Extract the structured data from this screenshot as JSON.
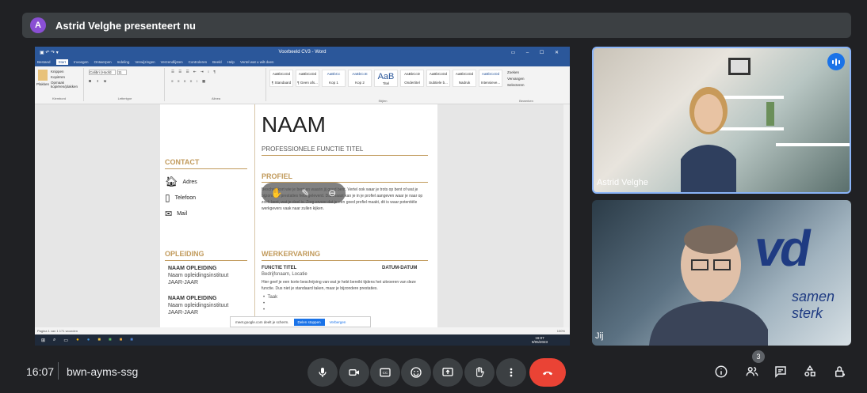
{
  "header": {
    "avatar_letter": "A",
    "presenting_text": "Astrid Velghe presenteert nu"
  },
  "word": {
    "window_title": "Voorbeeld CV3  -  Word",
    "tabs": [
      "Bestand",
      "Start",
      "Invoegen",
      "Ontwerpen",
      "Indeling",
      "Verwijzingen",
      "Verzendlijsten",
      "Controleren",
      "Beeld",
      "Help",
      "Vertel wat u wilt doen"
    ],
    "active_tab": "Start",
    "clipboard": {
      "paste": "Plakken",
      "cut": "Knippen",
      "copy": "Kopiëren",
      "painter": "Opmaak kopiëren/plakken",
      "label": "Klembord"
    },
    "font": {
      "name": "Calibri (Hoofd",
      "size": "11",
      "label": "Lettertype"
    },
    "paragraph_label": "Alinea",
    "styles": [
      {
        "sample": "AaBbCcDd",
        "name": "¶ Standaard"
      },
      {
        "sample": "AaBbCcDd",
        "name": "¶ Geen afs..."
      },
      {
        "sample": "AaBbCc",
        "name": "Kop 1"
      },
      {
        "sample": "AaBbCcE",
        "name": "Kop 2"
      },
      {
        "sample": "AaB",
        "name": "Titel"
      },
      {
        "sample": "AaBbCcD",
        "name": "Ondertitel"
      },
      {
        "sample": "AaBbCcDd",
        "name": "Subtiele b..."
      },
      {
        "sample": "AaBbCcDd",
        "name": "Nadruk"
      },
      {
        "sample": "AaBbCcDd",
        "name": "Intensieve..."
      }
    ],
    "styles_label": "Stijlen",
    "editing": {
      "find": "Zoeken",
      "replace": "Vervangen",
      "select": "Selecteren",
      "label": "Bewerken"
    },
    "status_left": "Pagina 1 van 1    171 woorden",
    "status_right": "100%",
    "taskbar_clock": "16:07",
    "taskbar_date": "9/05/2023"
  },
  "cv": {
    "name": "NAAM",
    "subtitle": "PROFESSIONELE FUNCTIE TITEL",
    "contact_heading": "CONTACT",
    "contact": [
      "Adres",
      "Telefoon",
      "Mail"
    ],
    "profile_heading": "PROFIEL",
    "profile_text": "Beschrijf kort wie je bent en waarin jij goed bent. Vertel ook waar je trots op bent of wat je bijzondere prestaties hebt geleverd. Daarnaast kan je in je profiel aangeven waar je naar op zoek bent, wat je doel is. Zorg ervoor dat je een goed profiel maakt, dit is waar potentiële werkgevers vaak naar zullen kijken.",
    "education_heading": "OPLEIDING",
    "education": [
      {
        "title": "NAAM OPLEIDING",
        "institute": "Naam opleidingsinstituut",
        "years": "JAAR-JAAR"
      },
      {
        "title": "NAAM OPLEIDING",
        "institute": "Naam opleidingsinstituut",
        "years": "JAAR-JAAR"
      }
    ],
    "experience_heading": "WERKERVARING",
    "job_title": "FUNCTIE TITEL",
    "job_date": "DATUM-DATUM",
    "job_company": "Bedrijfsnaam, Locatie",
    "job_desc": "Hier geef je een korte beschrijving van wat je hebt bereikt tijdens het uitvoeren van deze functie. Dus niet je standaard taken, maar je bijzondere prestaties.",
    "bullets": [
      "Taak",
      "",
      ""
    ]
  },
  "share_bar": {
    "text": "meet.google.com deelt je scherm.",
    "stop": "Delen stoppen",
    "hide": "Verbergen"
  },
  "participants": [
    {
      "name": "Astrid Velghe",
      "speaking": true
    },
    {
      "name": "Jij"
    }
  ],
  "tile2_sign": {
    "logo": "vd",
    "text": "samen sterk"
  },
  "bottom": {
    "time": "16:07",
    "meeting_code": "bwn-ayms-ssg",
    "people_count": "3"
  }
}
